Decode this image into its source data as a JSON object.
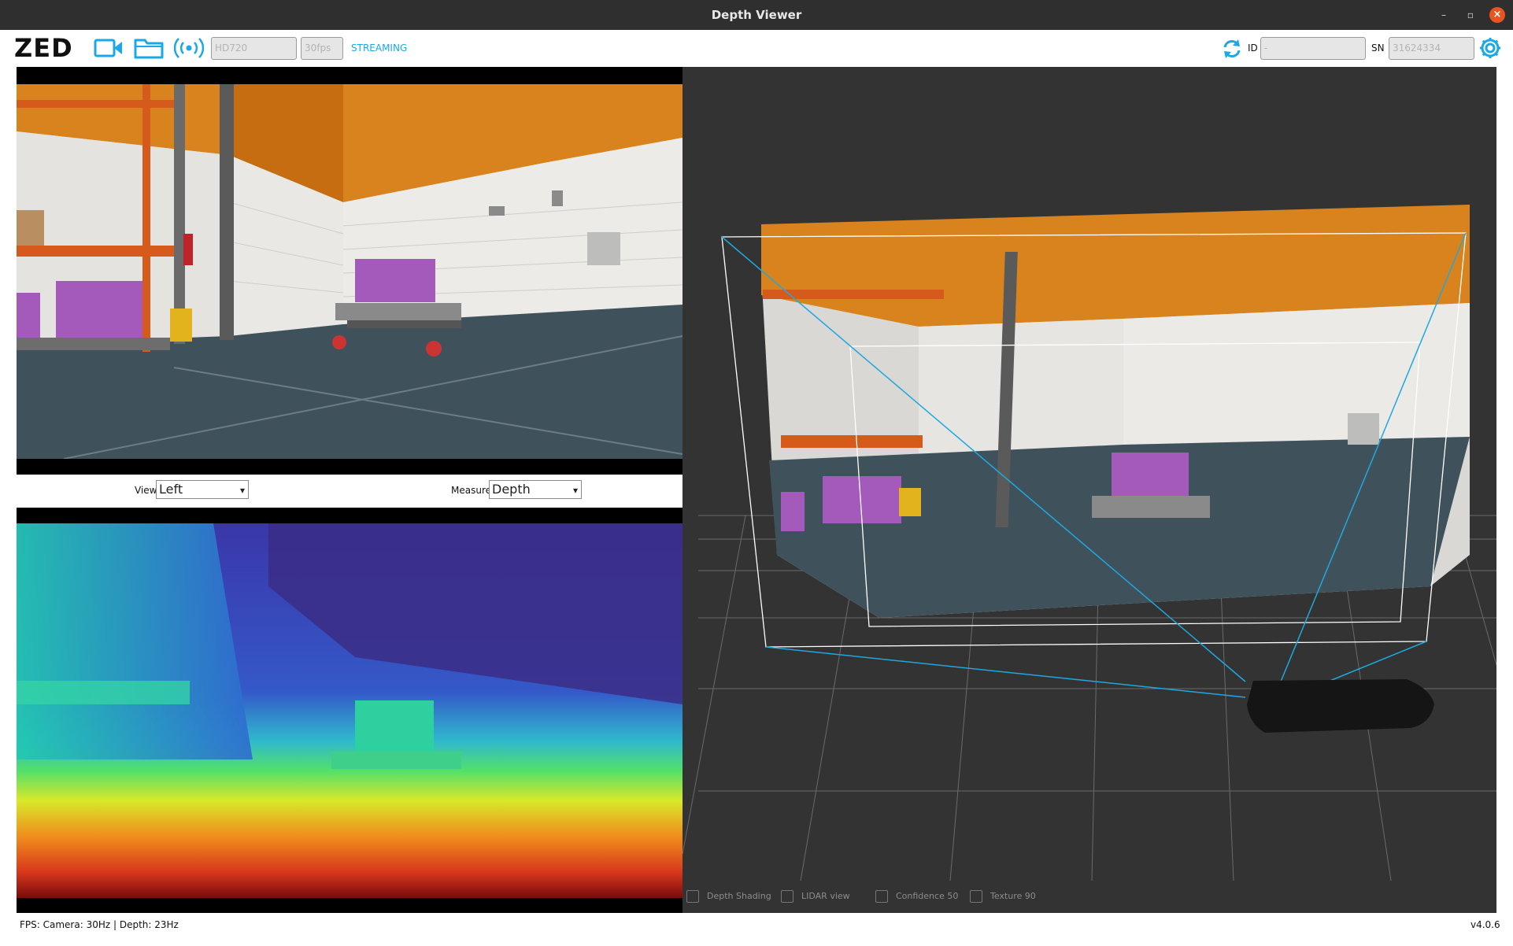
{
  "window": {
    "title": "Depth Viewer"
  },
  "toolbar": {
    "logo": "ZED",
    "resolution_value": "HD720",
    "fps_value": "30fps",
    "status": "STREAMING",
    "id_label": "ID",
    "id_value": "-",
    "sn_label": "SN",
    "sn_value": "31624334",
    "accent_color": "#19a9e6"
  },
  "controls": {
    "view_label": "View",
    "view_value": "Left",
    "measure_label": "Measure",
    "measure_value": "Depth"
  },
  "view3d": {
    "checkboxes": [
      {
        "label": "Depth Shading",
        "checked": false
      },
      {
        "label": "LIDAR view",
        "checked": false
      },
      {
        "label": "Confidence 50",
        "checked": false
      },
      {
        "label": "Texture 90",
        "checked": false
      }
    ]
  },
  "statusbar": {
    "fps_text": "FPS: Camera: 30Hz | Depth: 23Hz",
    "version": "v4.0.6"
  }
}
